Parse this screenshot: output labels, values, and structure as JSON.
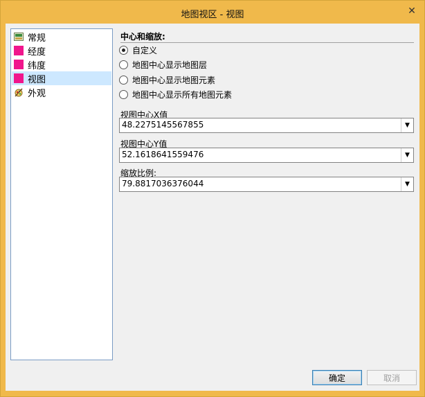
{
  "window": {
    "title": "地图视区 - 视图",
    "close_glyph": "✕"
  },
  "nav": {
    "items": [
      {
        "label": "常规",
        "icon": "general-icon"
      },
      {
        "label": "经度",
        "icon": "pink-swatch-icon",
        "color": "#f0168c"
      },
      {
        "label": "纬度",
        "icon": "pink-swatch-icon",
        "color": "#f0168c"
      },
      {
        "label": "视图",
        "icon": "pink-swatch-icon",
        "color": "#f0168c",
        "selected": true
      },
      {
        "label": "外观",
        "icon": "appearance-icon"
      }
    ]
  },
  "panel": {
    "title": "中心和缩放:",
    "radios": [
      {
        "label": "自定义",
        "checked": true
      },
      {
        "label": "地图中心显示地图层",
        "checked": false
      },
      {
        "label": "地图中心显示地图元素",
        "checked": false
      },
      {
        "label": "地图中心显示所有地图元素",
        "checked": false
      }
    ],
    "fields": [
      {
        "label": "视图中心X值",
        "value": "48.2275145567855"
      },
      {
        "label": "视图中心Y值",
        "value": "52.1618641559476"
      },
      {
        "label": "缩放比例:",
        "value": "79.8817036376044"
      }
    ]
  },
  "buttons": {
    "ok": "确定",
    "cancel": "取消"
  },
  "colors": {
    "titlebar": "#f0b94b",
    "selection": "#cde8ff",
    "swatch": "#f0168c"
  }
}
